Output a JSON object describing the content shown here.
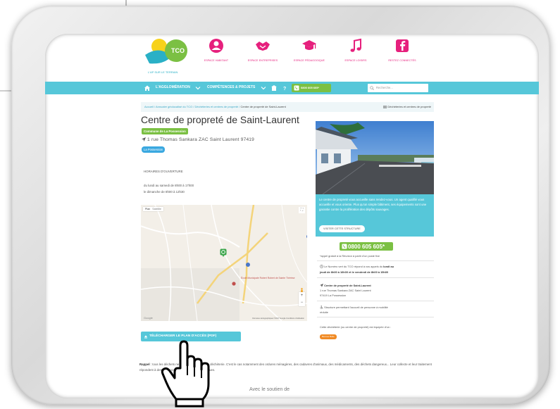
{
  "header": {
    "logo_text": "TCO",
    "logo_tagline": "L'AP SUR LE TERRAIN",
    "nav": [
      {
        "label": "ESPACE HABITANT",
        "icon": "person-icon"
      },
      {
        "label": "ESPACE ENTREPRISES",
        "icon": "handshake-icon"
      },
      {
        "label": "ESPACE PÉDAGOGIQUE",
        "icon": "graduation-cap-icon"
      },
      {
        "label": "ESPACE LOISIRS",
        "icon": "music-note-icon"
      },
      {
        "label": "RESTEZ CONNECTÉS",
        "icon": "facebook-icon"
      }
    ]
  },
  "menubar": {
    "item1": "L'AGGLOMÉRATION",
    "item2": "COMPÉTENCES & PROJETS",
    "phone": "0800 605 605*",
    "search_placeholder": "Recherche..."
  },
  "breadcrumb": {
    "path": "Accueil / Annuaire géolocalisé du TCO / Déchèteries et centres de propreté /",
    "current": "Centre de propreté de Saint-Laurent",
    "category": "Déchèteries et centres de propreté"
  },
  "place": {
    "title": "Centre de propreté de Saint-Laurent",
    "commune": "Commune de La Possession",
    "address": "1 rue Thomas Sankara ZAC Saint Laurent 97419",
    "city_badge": "La Possession",
    "hours_title": "HORAIRES D'OUVERTURE",
    "hours_1": "du lundi au samedi de 8h00 à 17h00",
    "hours_2": "le dimanche de 8h00 à 12h30"
  },
  "map": {
    "type_map": "Plan",
    "type_sat": "Satellite",
    "poi_label": "École Municipale Robert Robert de Sainte Thérèse",
    "attribution": "Données cartographiques ©2017 Google   Conditions d'utilisation",
    "google": "Google"
  },
  "download_label": "TÉLÉCHARGER LE PLAN D'ACCÈS (PDF)",
  "rappel": {
    "bold": "Rappel",
    "text": " : tous les déchets ne sont pas acceptés en déchèterie. C'est le cas notamment des ordures ménagères, des cadavres d'animaux, des médicaments, des déchets dangereux... Leur collecte et leur traitement répondent à des exigences réglementaires spécifiques."
  },
  "cut_text": "Avec le soutien de",
  "sidebar": {
    "info": "Le centre de propreté vous accueille sans rendez-vous. Un agent qualifié vous accueille et vous oriente. Plus qu'un simple bâtiment, ses équipements sont une garantie contre la prolifération des dépôts sauvages.",
    "visit_label": "VISITER CETTE STRUCTURE",
    "phone_big": "0800 605 605*",
    "phone_note": "*appel gratuit à la Réunion à partir d'un poste fixe",
    "numero_1a": "Le Numéro vert du TCO répond à vos appels du",
    "numero_1b": "lundi au",
    "numero_2": "jeudi de 8h00 à 16h00 et le vendredi de 8h00 à 15h00",
    "center_name": "Centre de propreté de Saint-Laurent",
    "center_addr1": "1 rue Thomas Sankara ZAC Saint Laurent",
    "center_addr2": "97419 La Possession",
    "mobility_1": "Structure permettant l'accueil de personne à mobilité",
    "mobility_2": "réduite",
    "equipped": "Cette déchèterie (ou centre de propreté) est équipée d'un :",
    "tag": "Bennes Bulle"
  },
  "colors": {
    "cyan": "#56c7d9",
    "green": "#7bc043",
    "pink": "#e6207d",
    "orange": "#f08a24"
  }
}
